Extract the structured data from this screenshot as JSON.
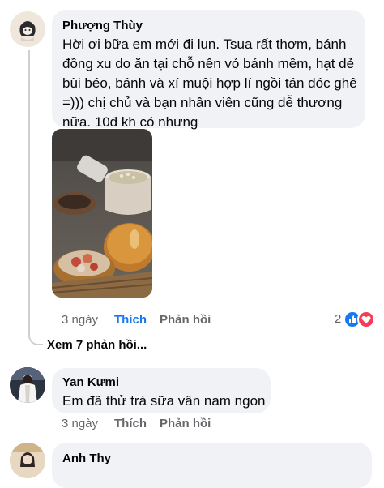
{
  "comments": [
    {
      "author": "Phượng Thùy",
      "lines": [
        "Hời ơi bữa em mới đi lun. Tsua rất thơm, bánh",
        "đồng xu do ăn tại chỗ nên vỏ bánh mềm, hạt dẻ",
        "bùi béo, bánh và xí muội hợp lí ngồi tán dóc ghê",
        "=))) chị chủ và bạn nhân viên cũng dễ thương",
        "nữa. 10đ kh có nhưng"
      ],
      "time": "3 ngày",
      "like": "Thích",
      "reply": "Phản hồi",
      "reaction_count": "2"
    },
    {
      "author": "Yan Kưmi",
      "text": "Em đã thử trà sữa vân nam ngon",
      "time": "3 ngày",
      "like": "Thích",
      "reply": "Phản hồi"
    },
    {
      "author": "Anh Thy"
    }
  ],
  "view_replies": "Xem 7 phản hồi...",
  "colors": {
    "bubble": "#f0f2f5",
    "meta": "#65676b",
    "like_active": "#1877f2",
    "like_reaction": "#1877f2",
    "love_reaction": "#f33e58"
  },
  "icons": [
    "like-reaction-icon",
    "love-reaction-icon"
  ]
}
